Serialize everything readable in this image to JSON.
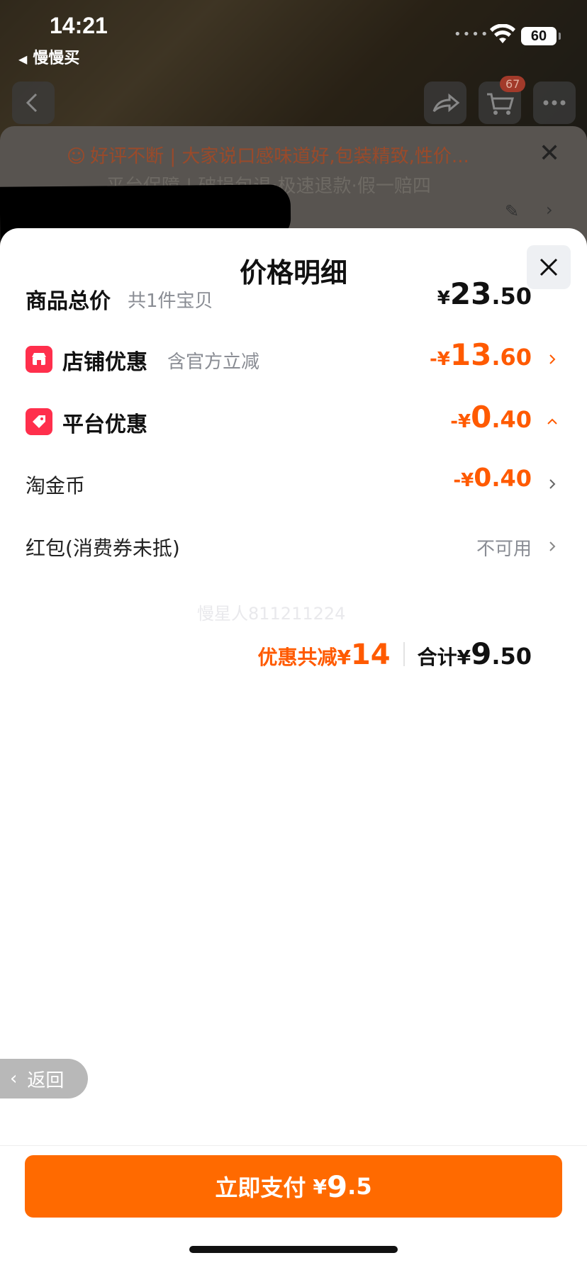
{
  "status_bar": {
    "time": "14:21",
    "back_app": "慢慢买",
    "battery": "60"
  },
  "background": {
    "cart_count": "67",
    "banner": "好评不断 | 大家说口感味道好,包装精致,性价...",
    "guarantee": "平台保障 | 破损包退·极速退款·假一赔四"
  },
  "sheet": {
    "title": "价格明细",
    "rows": {
      "total_goods": {
        "label": "商品总价",
        "sub": "共1件宝贝",
        "yen": "¥",
        "int": "23",
        "dec": ".50"
      },
      "store_discount": {
        "label": "店铺优惠",
        "sub": "含官方立减",
        "yen": "-¥",
        "int": "13",
        "dec": ".60"
      },
      "platform_discount": {
        "label": "平台优惠",
        "yen": "-¥",
        "int": "0",
        "dec": ".40"
      },
      "taojinbi": {
        "label": "淘金币",
        "yen": "-¥",
        "int": "0",
        "dec": ".40"
      },
      "red_packet": {
        "label": "红包(消费券未抵)",
        "value": "不可用"
      }
    },
    "watermark": "慢星人811211224",
    "totals": {
      "discount_label": "优惠共减¥",
      "discount_value": "14",
      "sum_label": "合计¥",
      "sum_int": "9",
      "sum_dec": ".50"
    },
    "back_label": "返回",
    "pay": {
      "label": "立即支付",
      "yen": "¥",
      "int": "9",
      "dec": ".5"
    }
  },
  "colors": {
    "accent_orange": "#ff6a00",
    "discount_orange": "#ff5a00",
    "badge_red": "#ff2f4c"
  }
}
